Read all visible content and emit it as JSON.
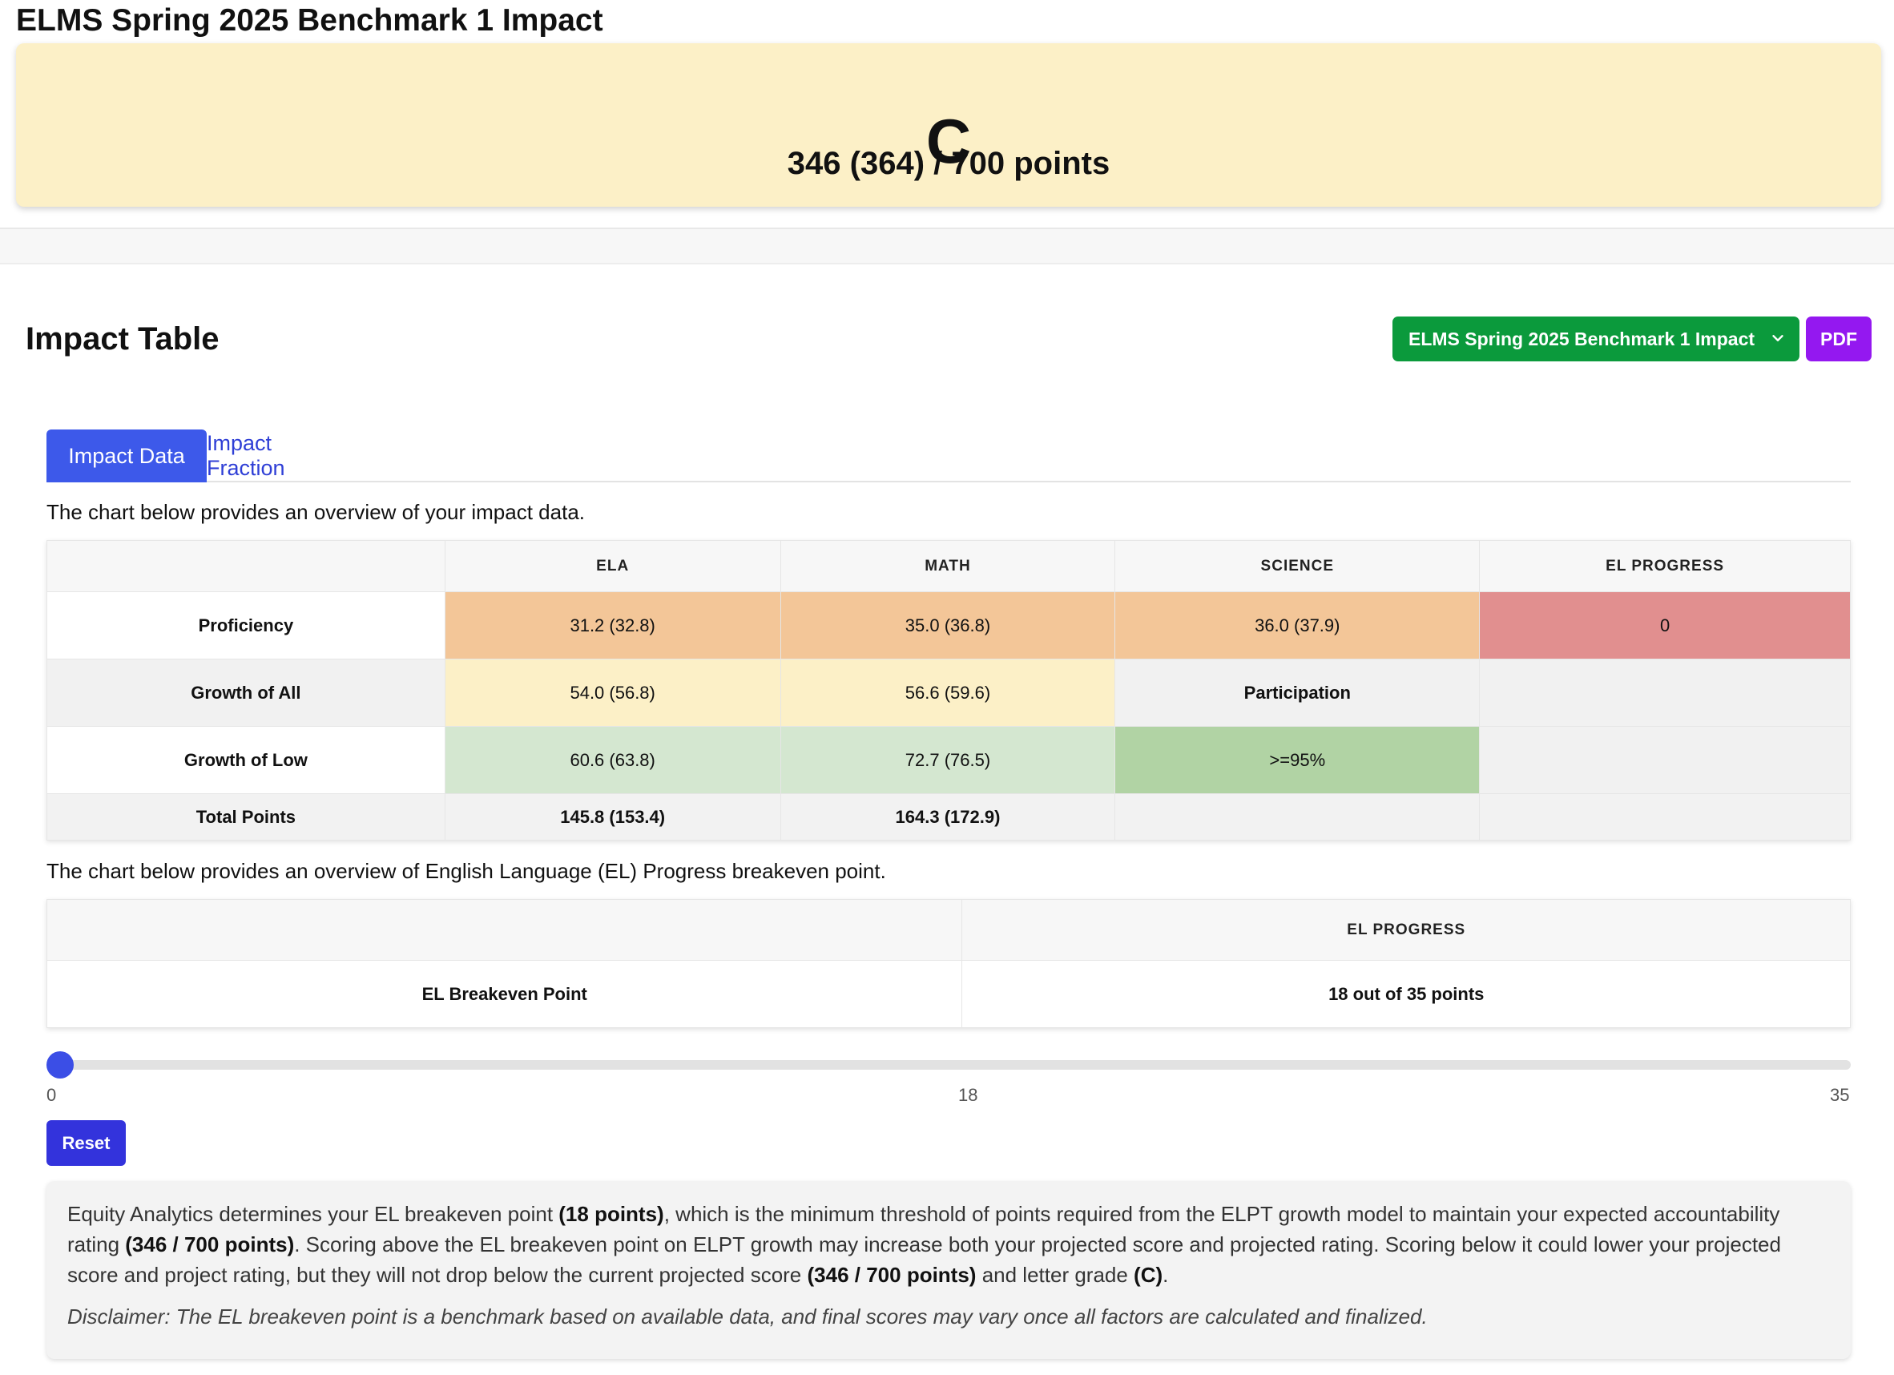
{
  "page_title": "ELMS Spring 2025 Benchmark 1 Impact",
  "grade": {
    "letter": "C",
    "points": "346 (364) / 700 points",
    "background_color": "#fcf0c7"
  },
  "header": {
    "title": "Impact Table",
    "dataset_select": {
      "value": "ELMS Spring 2025 Benchmark 1 Impact",
      "icon": "chevron-down-icon",
      "color": "#0b9a3c"
    },
    "pdf_label": "PDF",
    "pdf_color": "#9418f0"
  },
  "tabs": [
    {
      "label": "Impact Data",
      "active": true
    },
    {
      "label": "Impact Fraction",
      "active": false
    }
  ],
  "impact_intro": "The chart below provides an overview of your impact data.",
  "impact_table": {
    "columns": [
      "",
      "ELA",
      "MATH",
      "SCIENCE",
      "EL PROGRESS"
    ],
    "rows": [
      {
        "label": "Proficiency",
        "cells": [
          "31.2 (32.8)",
          "35.0 (36.8)",
          "36.0 (37.9)",
          "0"
        ]
      },
      {
        "label": "Growth of All",
        "cells": [
          "54.0 (56.8)",
          "56.6 (59.6)",
          "Participation",
          ""
        ]
      },
      {
        "label": "Growth of Low",
        "cells": [
          "60.6 (63.8)",
          "72.7 (76.5)",
          ">=95%",
          ""
        ]
      },
      {
        "label": "Total Points",
        "cells": [
          "145.8 (153.4)",
          "164.3 (172.9)",
          "",
          ""
        ]
      }
    ],
    "colors": {
      "proficiency": "#f3c698",
      "el_progress_low": "#e18f8f",
      "growth_all": "#fcf0c7",
      "growth_low": "#d4e7d0",
      "participation_met": "#b1d3a4"
    }
  },
  "el_intro": "The chart below provides an overview of English Language (EL) Progress breakeven point.",
  "el_table": {
    "columns": [
      "",
      "EL PROGRESS"
    ],
    "row": {
      "label": "EL Breakeven Point",
      "value": "18 out of 35 points"
    }
  },
  "slider": {
    "min": 0,
    "max": 35,
    "value": 0,
    "labels": [
      "0",
      "18",
      "35"
    ],
    "color": "#3b4ee6"
  },
  "reset_label": "Reset",
  "info": {
    "p1_a": "Equity Analytics determines your EL breakeven point ",
    "p1_b": "(18 points)",
    "p1_c": ", which is the minimum threshold of points required from the ELPT growth model to maintain your expected accountability rating ",
    "p1_d": "(346 / 700 points)",
    "p1_e": ". Scoring above the EL breakeven point on ELPT growth may increase both your projected score and projected rating. Scoring below it could lower your projected score and project rating, but they will not drop below the current projected score ",
    "p1_f": "(346 / 700 points)",
    "p1_g": " and letter grade ",
    "p1_h": "(C)",
    "p1_i": ".",
    "disclaimer": "Disclaimer: The EL breakeven point is a benchmark based on available data, and final scores may vary once all factors are calculated and finalized."
  }
}
